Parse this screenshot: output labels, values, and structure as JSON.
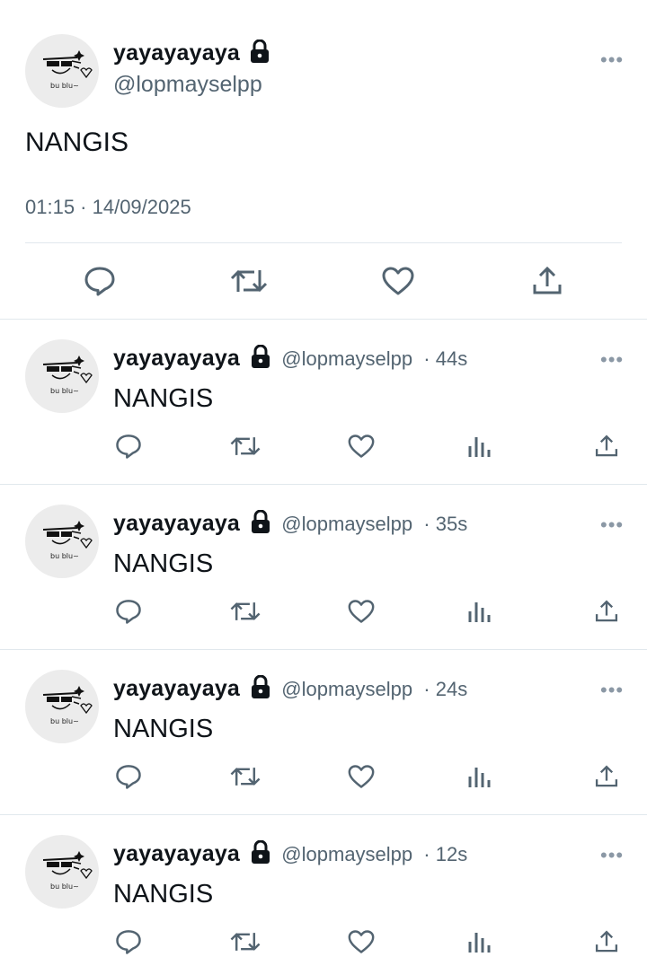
{
  "main_tweet": {
    "name": "yayayayaya",
    "handle": "@lopmayselpp",
    "text": "NANGIS",
    "timestamp": "01:15 · 14/09/2025",
    "avatar_text": "bu blu~",
    "actions": [
      "reply-icon",
      "retweet-icon",
      "like-icon",
      "share-icon"
    ]
  },
  "replies": [
    {
      "name": "yayayayaya",
      "handle": "@lopmayselpp",
      "time": "· 44s",
      "text": "NANGIS",
      "avatar_text": "bu blu~"
    },
    {
      "name": "yayayayaya",
      "handle": "@lopmayselpp",
      "time": "· 35s",
      "text": "NANGIS",
      "avatar_text": "bu blu~"
    },
    {
      "name": "yayayayaya",
      "handle": "@lopmayselpp",
      "time": "· 24s",
      "text": "NANGIS",
      "avatar_text": "bu blu~"
    },
    {
      "name": "yayayayaya",
      "handle": "@lopmayselpp",
      "time": "· 12s",
      "text": "NANGIS",
      "avatar_text": "bu blu~"
    }
  ],
  "more_label": "•••",
  "colors": {
    "text": "#0f1419",
    "secondary": "#536471",
    "divider": "#e1e8ed",
    "icon": "#536471"
  }
}
